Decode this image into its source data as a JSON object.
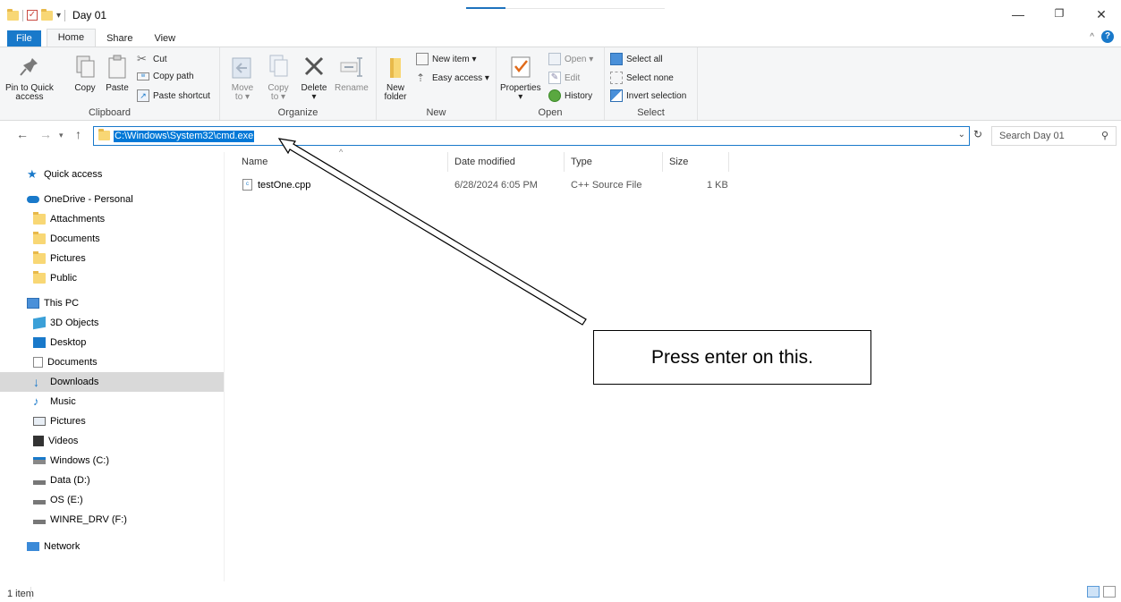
{
  "window": {
    "title": "Day 01",
    "controls": {
      "minimize": "—",
      "maximize": "❐",
      "close": "✕"
    }
  },
  "ribbon_tabs": [
    "File",
    "Home",
    "Share",
    "View"
  ],
  "ribbon": {
    "clipboard": {
      "label": "Clipboard",
      "pin_line1": "Pin to Quick",
      "pin_line2": "access",
      "copy": "Copy",
      "paste": "Paste",
      "cut": "Cut",
      "copy_path": "Copy path",
      "paste_shortcut": "Paste shortcut"
    },
    "organize": {
      "label": "Organize",
      "move_to_1": "Move",
      "move_to_2": "to ▾",
      "copy_to_1": "Copy",
      "copy_to_2": "to ▾",
      "delete_1": "Delete",
      "delete_2": "▾",
      "rename": "Rename"
    },
    "new": {
      "label": "New",
      "new_folder_1": "New",
      "new_folder_2": "folder",
      "new_item": "New item ▾",
      "easy_access": "Easy access ▾"
    },
    "open": {
      "label": "Open",
      "properties_1": "Properties",
      "properties_2": "▾",
      "open": "Open ▾",
      "edit": "Edit",
      "history": "History"
    },
    "select": {
      "label": "Select",
      "select_all": "Select all",
      "select_none": "Select none",
      "invert": "Invert selection"
    }
  },
  "address_bar": {
    "path": "C:\\Windows\\System32\\cmd.exe",
    "search_placeholder": "Search Day 01"
  },
  "nav_pane": {
    "quick_access": "Quick access",
    "onedrive": "OneDrive - Personal",
    "onedrive_items": [
      "Attachments",
      "Documents",
      "Pictures",
      "Public"
    ],
    "this_pc": "This PC",
    "pc_items": [
      "3D Objects",
      "Desktop",
      "Documents",
      "Downloads",
      "Music",
      "Pictures",
      "Videos",
      "Windows (C:)",
      "Data (D:)",
      "OS (E:)",
      "WINRE_DRV (F:)"
    ],
    "network": "Network",
    "selected": "Downloads"
  },
  "file_list": {
    "columns": [
      "Name",
      "Date modified",
      "Type",
      "Size"
    ],
    "rows": [
      {
        "name": "testOne.cpp",
        "date": "6/28/2024 6:05 PM",
        "type": "C++ Source File",
        "size": "1 KB"
      }
    ]
  },
  "annotation": {
    "text": "Press enter on this."
  },
  "status_bar": {
    "count": "1 item"
  },
  "colors": {
    "accent": "#1979ca",
    "selection": "#0078d7",
    "nav_selected": "#d9d9d9",
    "folder": "#f8d775"
  }
}
